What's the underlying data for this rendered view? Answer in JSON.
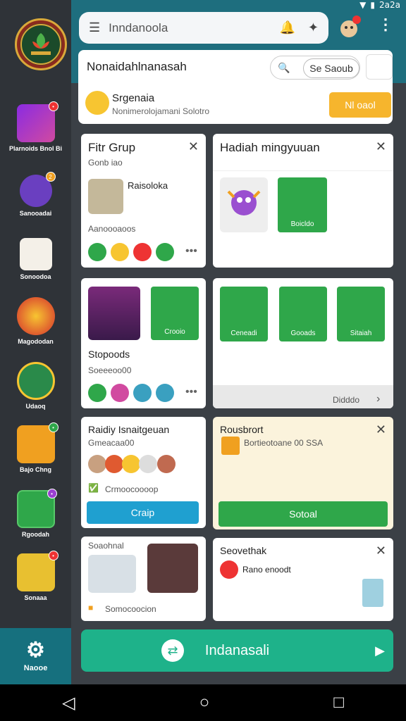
{
  "status": {
    "time": "2a2a"
  },
  "header": {
    "search_text": "Inndanoola",
    "bell_icon": "bell-icon",
    "filter_icon": "filter-icon",
    "menu_icon": "menu-icon"
  },
  "logo": {
    "text": "logo"
  },
  "sidebar": {
    "items": [
      {
        "label": "Plarnoids Bnol Bi",
        "icon": "avatar-icon"
      },
      {
        "label": "Sanooadai",
        "icon": "video-icon"
      },
      {
        "label": "Sonoodoa",
        "icon": "game-icon"
      },
      {
        "label": "Magododan",
        "icon": "fire-icon"
      },
      {
        "label": "Udaoq",
        "icon": "avatar-icon"
      },
      {
        "label": "Bajo Chng",
        "icon": "avatar-icon"
      },
      {
        "label": "Rgoodah",
        "icon": "avatar-icon"
      },
      {
        "label": "Sonaaa",
        "icon": "avatar-icon"
      }
    ],
    "nav_label": "Naooe"
  },
  "profile": {
    "title": "Nonaidahlnanasah",
    "search_btn": "Se Saoub",
    "name": "Srgenaia",
    "sub": "Nonimerolojamani Solotro",
    "button": "Nl oaol"
  },
  "card1": {
    "title": "Fitr Grup",
    "sub": "Gonb iao",
    "user": "Raisoloka",
    "desc": "Aanoooaoos"
  },
  "card2": {
    "title": "Hadiah mingyuuan",
    "gift_label": "Boicldo"
  },
  "card3": {
    "label": "Crooio",
    "name": "Stopoods",
    "sub": "Soeeeoo00"
  },
  "card4": {
    "items": [
      "Ceneadi",
      "Gooads",
      "Sitaiah"
    ],
    "footer": "Didddo"
  },
  "card5": {
    "title": "Raidiy Isnaitgeuan",
    "sub": "Gmeacaa00",
    "item": "Crmoocoooop",
    "button": "Craip"
  },
  "card6": {
    "title": "Rousbrort",
    "desc": "Bortieotoane 00 SSA",
    "button": "Sotoal"
  },
  "card7": {
    "user": "Soaohnal",
    "footer": "Somocoocion"
  },
  "card8": {
    "title": "Seovethak",
    "item": "Rano enoodt"
  },
  "bottom": {
    "label": "Indanasali"
  }
}
